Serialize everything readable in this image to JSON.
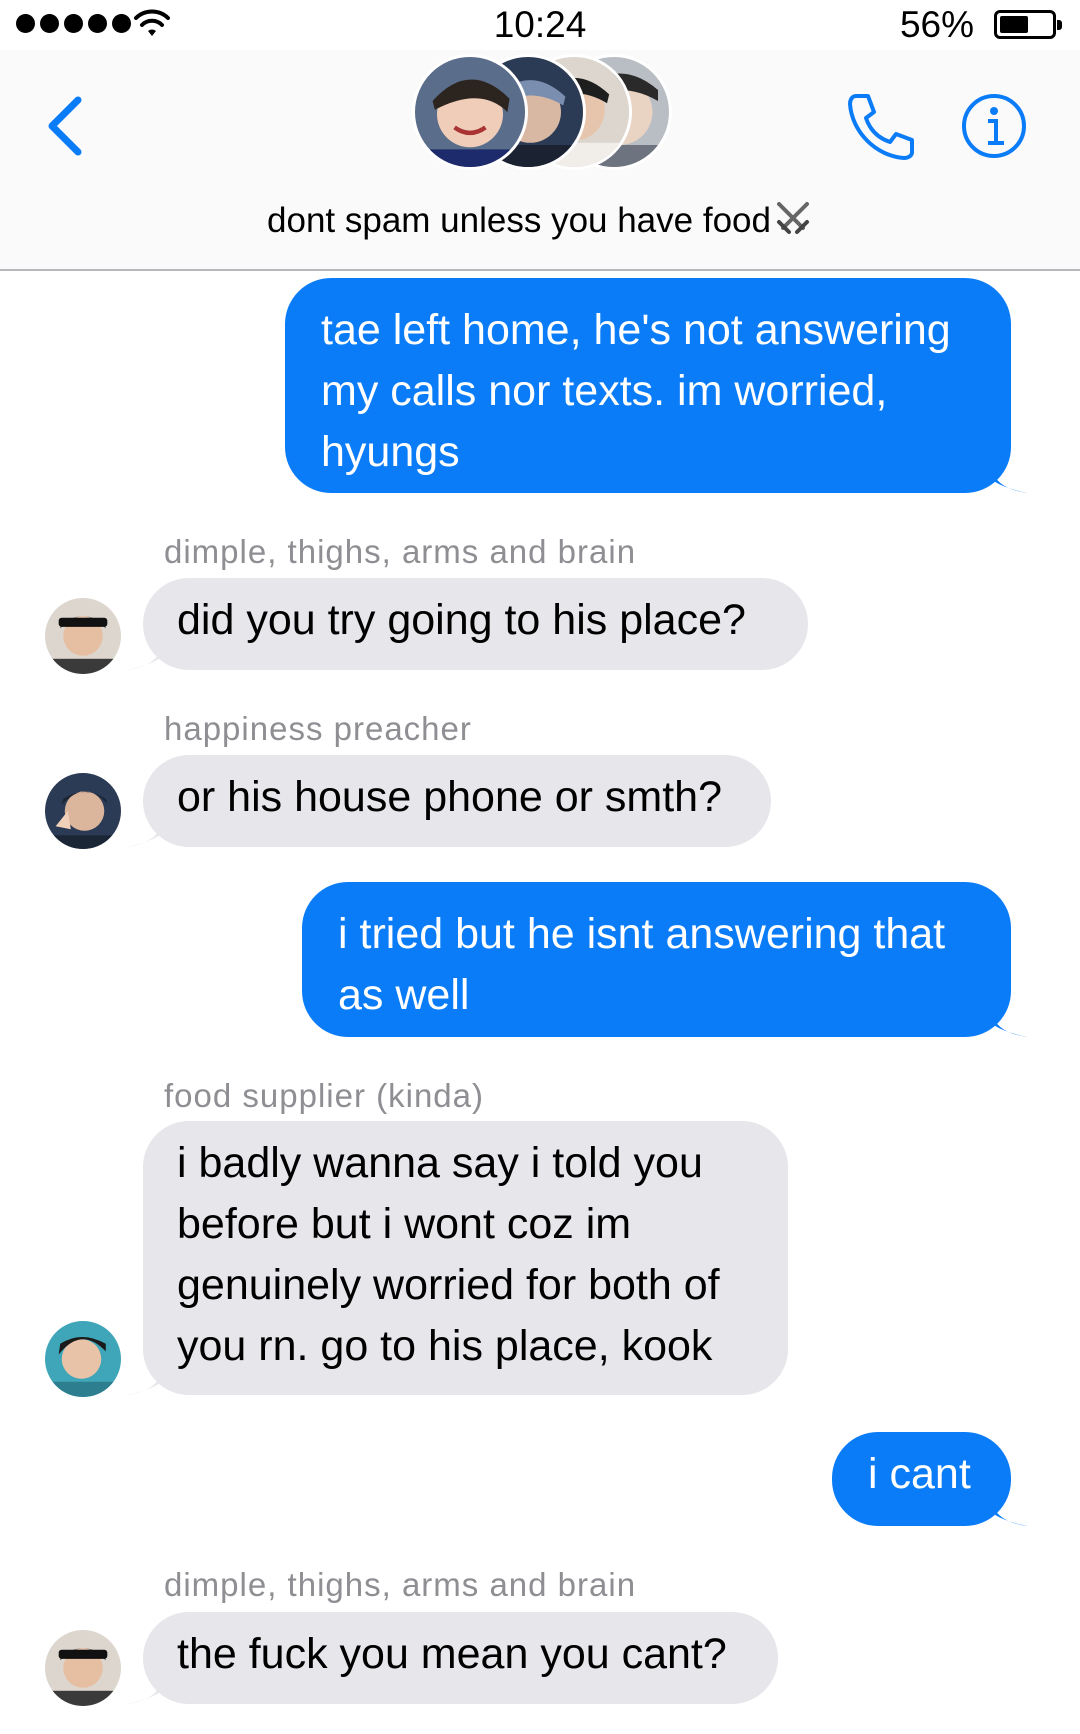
{
  "status_bar": {
    "time": "10:24",
    "battery_percent": "56%",
    "battery_level": 0.56,
    "signal_dots": 5
  },
  "header": {
    "group_name": "dont spam unless you have food",
    "group_emoji": "crossed-swords",
    "accent_color": "#0b7cf7"
  },
  "messages": [
    {
      "direction": "outgoing",
      "text": "tae left home, he's not answering\nmy calls nor texts. im worried,\nhyungs"
    },
    {
      "direction": "incoming",
      "sender": "dimple, thighs, arms and brain",
      "text": "did you try going to his place?"
    },
    {
      "direction": "incoming",
      "sender": "happiness preacher",
      "text": "or his house phone or smth?"
    },
    {
      "direction": "outgoing",
      "text": "i tried but he isnt answering that\nas well"
    },
    {
      "direction": "incoming",
      "sender": "food supplier (kinda)",
      "text": "i badly wanna say i told you\nbefore but i wont coz im\ngenuinely worried for both of\nyou rn. go to his place, kook"
    },
    {
      "direction": "outgoing",
      "text": "i cant"
    },
    {
      "direction": "incoming",
      "sender": "dimple, thighs, arms and brain",
      "text": "the fuck you mean you cant?"
    }
  ],
  "colors": {
    "outgoing_bubble": "#0b7cf7",
    "incoming_bubble": "#e6e6eb",
    "sender_label": "#8e8e93"
  }
}
